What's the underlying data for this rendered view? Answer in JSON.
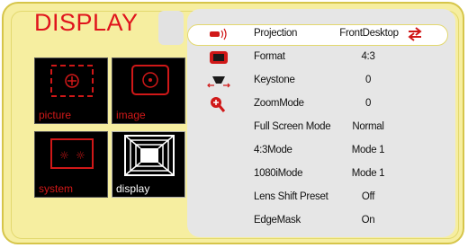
{
  "menu": {
    "title": "DISPLAY"
  },
  "tiles": [
    {
      "label": "picture",
      "icon": "picture-icon"
    },
    {
      "label": "image",
      "icon": "image-icon"
    },
    {
      "label": "system",
      "icon": "system-icon"
    },
    {
      "label": "display",
      "icon": "display-icon"
    }
  ],
  "settings": [
    {
      "label": "Projection",
      "value": "FrontDesktop",
      "icon": "projection-icon",
      "selected": true
    },
    {
      "label": "Format",
      "value": "4:3",
      "icon": "format-icon"
    },
    {
      "label": "Keystone",
      "value": "0",
      "icon": "keystone-icon"
    },
    {
      "label": "ZoomMode",
      "value": "0",
      "icon": "zoom-icon"
    },
    {
      "label": "Full Screen Mode",
      "value": "Normal"
    },
    {
      "label": "4:3Mode",
      "value": "Mode 1"
    },
    {
      "label": "1080iMode",
      "value": "Mode 1"
    },
    {
      "label": "Lens Shift Preset",
      "value": "Off"
    },
    {
      "label": "EdgeMask",
      "value": "On"
    }
  ],
  "colors": {
    "accent": "#e0141c",
    "frame": "#f6eea0",
    "panel": "#e6e6e6"
  }
}
